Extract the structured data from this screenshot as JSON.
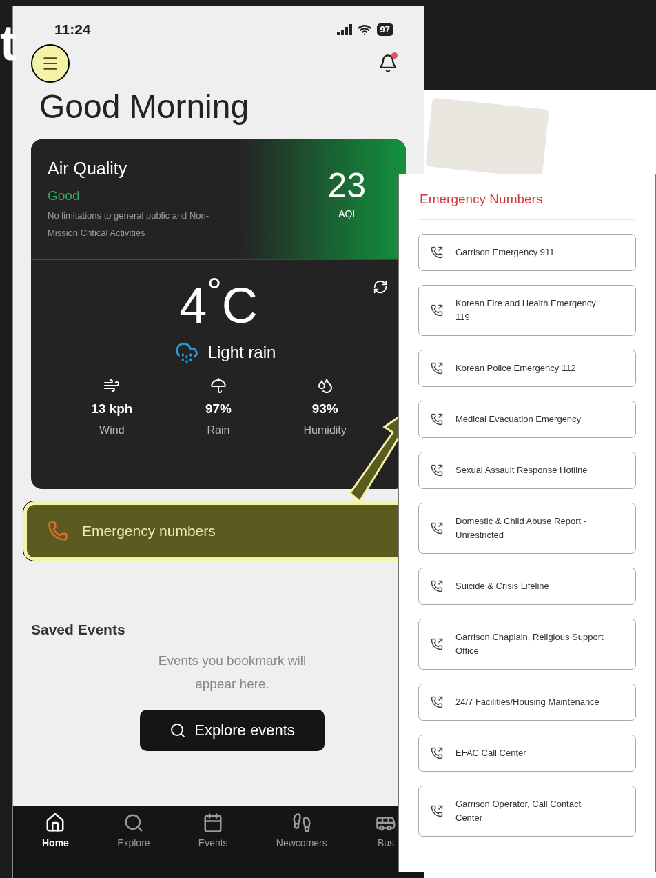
{
  "annotation": {
    "text": "t",
    "menu_highlighted": true
  },
  "status_bar": {
    "time": "11:24",
    "battery": "97"
  },
  "header": {
    "greeting": "Good Morning",
    "notification_unread": true
  },
  "air_quality": {
    "title": "Air Quality",
    "status": "Good",
    "description": "No limitations to general public and Non-Mission Critical Activities",
    "value": "23",
    "unit": "AQI"
  },
  "weather": {
    "temperature": "4$^{°}$C",
    "condition": "Light rain",
    "stats": [
      {
        "kind": "wind",
        "value": "13 kph",
        "label": "Wind"
      },
      {
        "kind": "rain",
        "value": "97%",
        "label": "Rain"
      },
      {
        "kind": "humidity",
        "value": "93%",
        "label": "Humidity"
      }
    ]
  },
  "emergency_bar": {
    "label": "Emergency numbers",
    "highlighted": true
  },
  "saved_events": {
    "title": "Saved Events",
    "empty_message": "Events you bookmark will appear here.",
    "button": "Explore events"
  },
  "bottom_nav": [
    {
      "kind": "home",
      "label": "Home",
      "selected": true
    },
    {
      "kind": "explore",
      "label": "Explore",
      "selected": false
    },
    {
      "kind": "events",
      "label": "Events",
      "selected": false
    },
    {
      "kind": "newcomers",
      "label": "Newcomers",
      "selected": false
    },
    {
      "kind": "bus",
      "label": "Bus",
      "selected": false
    }
  ],
  "emergency_panel": {
    "title": "Emergency Numbers",
    "items": [
      "Garrison Emergency 911",
      "Korean Fire and Health Emergency 119",
      "Korean Police Emergency 112",
      "Medical Evacuation Emergency",
      "Sexual Assault Response Hotline",
      "Domestic & Child Abuse Report - Unrestricted",
      "Suicide & Crisis Lifeline",
      "Garrison Chaplain, Religious Support Office",
      "24/7 Facilities/Housing Maintenance",
      "EFAC Call Center",
      "Garrison Operator, Call Contact Center"
    ]
  }
}
